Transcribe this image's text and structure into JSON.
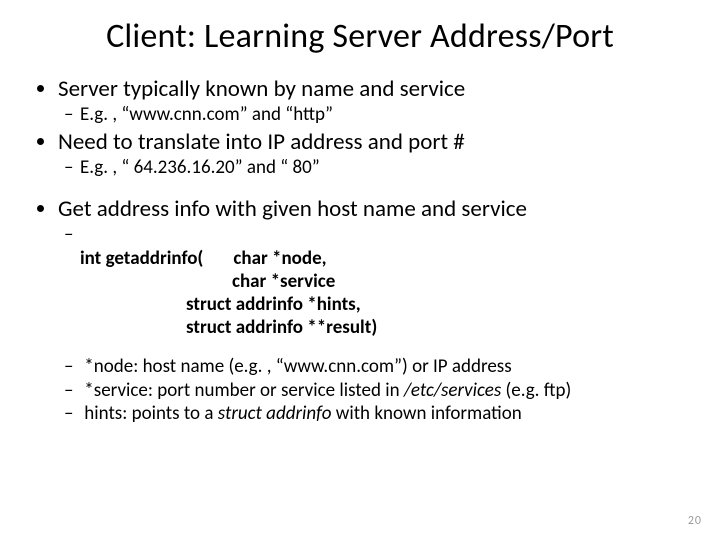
{
  "title": "Client: Learning Server Address/Port",
  "b1": "Server typically known by name and service",
  "b1s1": "E.g. , “www.cnn.com” and “http”",
  "b2": "Need to translate into IP address and port #",
  "b2s1": "E.g. , “ 64.236.16.20” and “ 80”",
  "b3": "Get address info with given host name and service",
  "code_l1": "int getaddrinfo(       char *node,",
  "code_l2": "char *service",
  "code_l3": "struct addrinfo *hints,",
  "code_l4": "struct addrinfo **result)",
  "p_node_a": "*node: host name (e.g. , ",
  "p_node_b": "“www.cnn.com”",
  "p_node_c": ") or IP address",
  "p_service_a": "*service: port number or service listed in ",
  "p_service_b": "/etc/services",
  "p_service_c": " (e.g. ftp)",
  "p_hints_a": "hints: points to a  ",
  "p_hints_b": "struct addrinfo",
  "p_hints_c": " with known information",
  "pagenum": "20"
}
